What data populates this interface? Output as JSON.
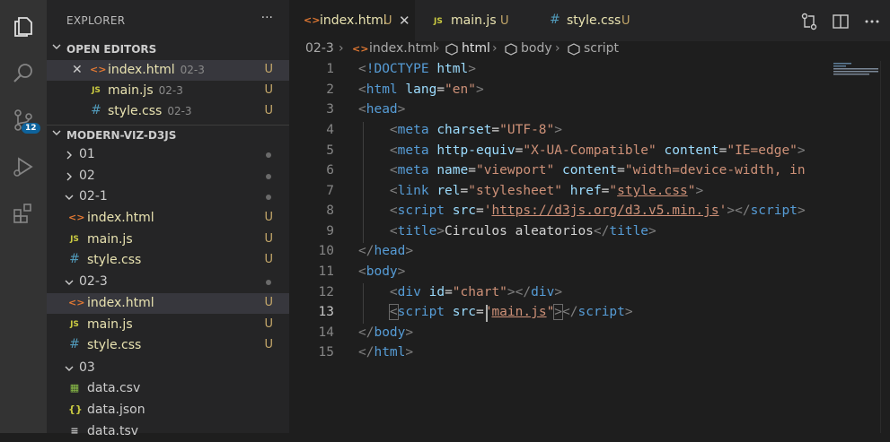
{
  "activity_bar": {
    "items": [
      "explorer-icon",
      "search-icon",
      "source-control-icon",
      "run-debug-icon",
      "extensions-icon"
    ],
    "scm_badge": "12"
  },
  "sidebar": {
    "title": "EXPLORER",
    "more": "···",
    "open_editors": {
      "label": "OPEN EDITORS",
      "items": [
        {
          "name": "index.html",
          "folder": "02-3",
          "status": "U",
          "icon": "html-icon"
        },
        {
          "name": "main.js",
          "folder": "02-3",
          "status": "U",
          "icon": "js-icon"
        },
        {
          "name": "style.css",
          "folder": "02-3",
          "status": "U",
          "icon": "css-icon"
        }
      ]
    },
    "workspace": {
      "label": "MODERN-VIZ-D3JS",
      "tree": [
        {
          "name": "01",
          "type": "folder"
        },
        {
          "name": "02",
          "type": "folder"
        },
        {
          "name": "02-1",
          "type": "folder"
        },
        {
          "name": "index.html",
          "status": "U"
        },
        {
          "name": "main.js",
          "status": "U"
        },
        {
          "name": "style.css",
          "status": "U"
        },
        {
          "name": "02-3",
          "type": "folder"
        },
        {
          "name": "index.html",
          "status": "U"
        },
        {
          "name": "main.js",
          "status": "U"
        },
        {
          "name": "style.css",
          "status": "U"
        },
        {
          "name": "03",
          "type": "folder"
        },
        {
          "name": "data.csv"
        },
        {
          "name": "data.json"
        },
        {
          "name": "data.tsv"
        }
      ]
    }
  },
  "tabs": [
    {
      "label": "index.html",
      "status": "U",
      "active": true,
      "close": "✕"
    },
    {
      "label": "main.js",
      "status": "U",
      "active": false
    },
    {
      "label": "style.css",
      "status": "U",
      "active": false
    }
  ],
  "breadcrumb": [
    "02-3",
    "index.html",
    "html",
    "body",
    "script"
  ],
  "editor": {
    "current_line": 13,
    "line_numbers": [
      "1",
      "2",
      "3",
      "4",
      "5",
      "6",
      "7",
      "8",
      "9",
      "10",
      "11",
      "12",
      "13",
      "14",
      "15"
    ]
  },
  "colors": {
    "accent": "#0e639c",
    "untracked": "#c5a86a",
    "tag": "#569cd6",
    "attr": "#9cdcfe",
    "string": "#ce9178"
  }
}
